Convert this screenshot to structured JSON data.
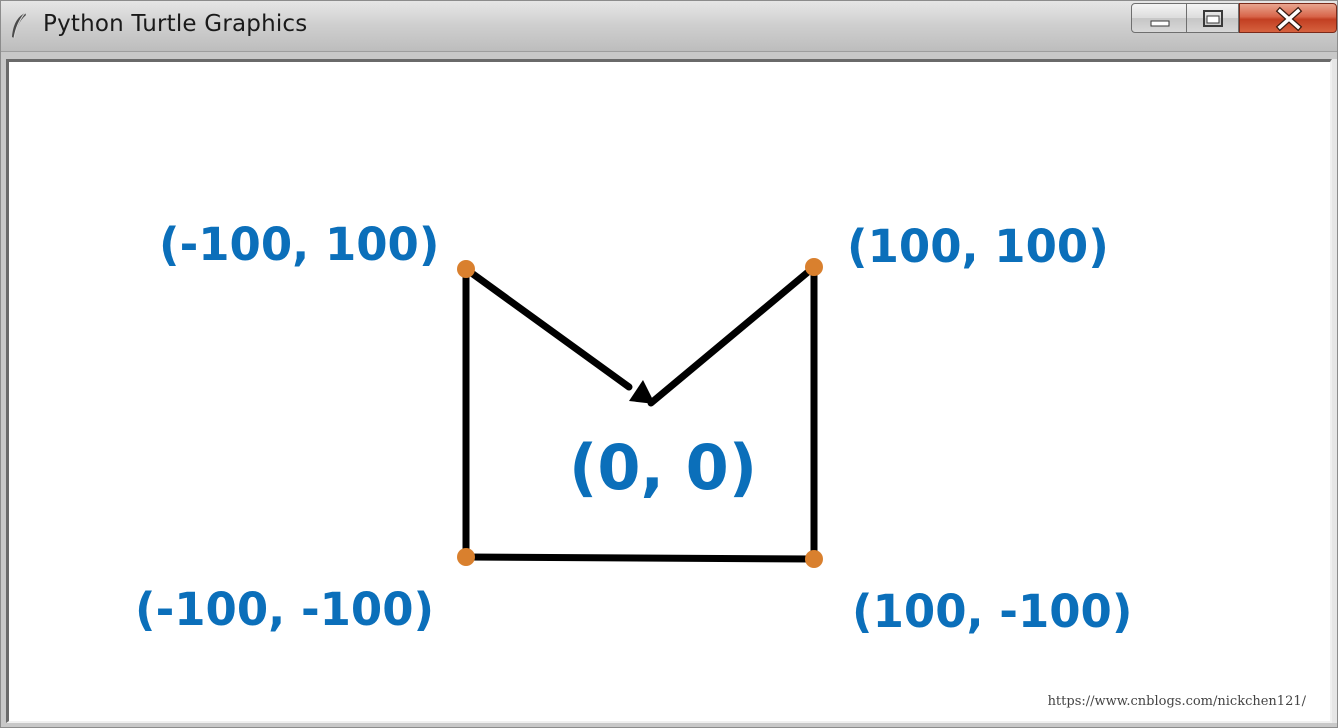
{
  "window": {
    "title": "Python Turtle Graphics",
    "icon": "feather-icon"
  },
  "controls": {
    "minimize_icon": "minimize-icon",
    "maximize_icon": "maximize-icon",
    "close_icon": "close-icon"
  },
  "canvas": {
    "labels": {
      "top_left": "(-100, 100)",
      "top_right": "(100, 100)",
      "center": "(0, 0)",
      "bottom_left": "(-100, -100)",
      "bottom_right": "(100, -100)"
    },
    "watermark": "https://www.cnblogs.com/nickchen121/",
    "colors": {
      "label": "#0b6fba",
      "line": "#000000",
      "dot": "#d9802e"
    }
  }
}
